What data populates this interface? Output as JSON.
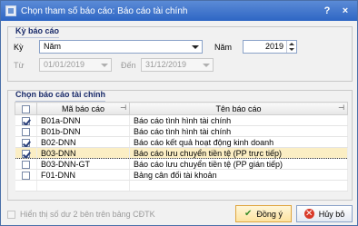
{
  "window": {
    "title": "Chọn tham số báo cáo: Báo cáo tài chính",
    "help_glyph": "?",
    "close_glyph": "×"
  },
  "period": {
    "group_title": "Kỳ báo cáo",
    "ky_label": "Kỳ",
    "ky_value": "Năm",
    "nam_label": "Năm",
    "nam_value": "2019",
    "tu_label": "Từ",
    "tu_value": "01/01/2019",
    "den_label": "Đến",
    "den_value": "31/12/2019"
  },
  "reports": {
    "group_title": "Chọn báo cáo tài chính",
    "columns": {
      "code": "Mã báo cáo",
      "name": "Tên báo cáo",
      "pin_glyph": "⊣"
    },
    "rows": [
      {
        "checked": true,
        "code": "B01a-DNN",
        "name": "Báo cáo tình hình tài chính"
      },
      {
        "checked": false,
        "code": "B01b-DNN",
        "name": "Báo cáo tình hình tài chính"
      },
      {
        "checked": true,
        "code": "B02-DNN",
        "name": "Báo cáo kết quả hoạt động kinh doanh"
      },
      {
        "checked": true,
        "code": "B03-DNN",
        "name": "Báo cáo lưu chuyển tiền tệ (PP trực tiếp)",
        "selected": true
      },
      {
        "checked": false,
        "code": "B03-DNN-GT",
        "name": "Báo cáo lưu chuyển tiền tệ (PP gián tiếp)"
      },
      {
        "checked": false,
        "code": "F01-DNN",
        "name": "Bảng cân đối tài khoản"
      },
      {
        "checked": false,
        "code": "",
        "name": ""
      }
    ]
  },
  "options": {
    "show_balance_label": "Hiển thị số dư 2 bên trên bảng CĐTK"
  },
  "buttons": {
    "ok_label": "Đồng ý",
    "cancel_label": "Hủy bỏ"
  },
  "colors": {
    "titlebar": "#2e66c4",
    "selected_row": "#fbeec4",
    "primary_button": "#fde3a0"
  }
}
